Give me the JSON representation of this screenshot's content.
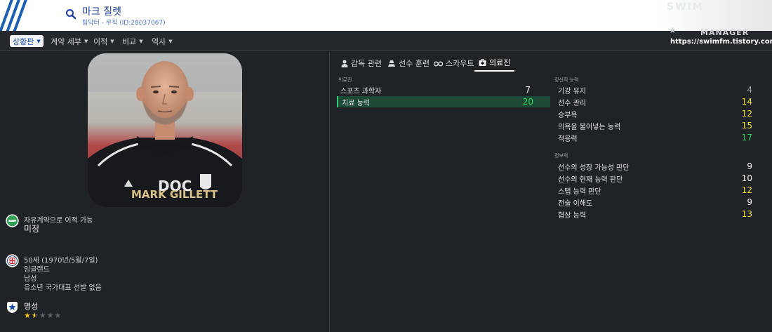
{
  "header": {
    "title": "마크 질렛",
    "subtitle": "팀닥터 - 무직 (ID:28037067)",
    "watermark_logo": "SWIM",
    "watermark_manager": "MANAGER",
    "site_url": "https://swimfm.tistory.com/"
  },
  "nav": {
    "items": [
      {
        "label": "상황판"
      },
      {
        "label": "계약 세부"
      },
      {
        "label": "이적"
      },
      {
        "label": "비교"
      },
      {
        "label": "역사"
      }
    ]
  },
  "profile": {
    "shirt_sponsor": "DOC",
    "shirt_name": "MARK GILLETT",
    "contract_status_label": "자유계약으로 이적 가능",
    "contract_status_value": "미정",
    "age_line": "50세 (1970년/5월/7일)",
    "nationality": "잉글랜드",
    "gender": "남성",
    "youth_caps": "유소년 국가대표 선발 없음",
    "reputation_label": "명성",
    "reputation_stars": 1.5,
    "reputation_max": 5
  },
  "tabs": [
    {
      "label": "감독 관련",
      "icon": "person-icon"
    },
    {
      "label": "선수 훈련",
      "icon": "training-cone-icon"
    },
    {
      "label": "스카우트",
      "icon": "binoculars-icon"
    },
    {
      "label": "의료진",
      "icon": "medical-kit-icon"
    }
  ],
  "medical": {
    "section_label": "의료진",
    "attributes": [
      {
        "name": "스포츠 과학자",
        "value": "7",
        "color": "#ffffff"
      },
      {
        "name": "치료 능력",
        "value": "20",
        "color": "#2ed35c"
      }
    ]
  },
  "mental": {
    "section_label": "정신적 능력",
    "attributes": [
      {
        "name": "기강 유지",
        "value": "4",
        "color": "#9ea3a8"
      },
      {
        "name": "선수 관리",
        "value": "14",
        "color": "#f0e130"
      },
      {
        "name": "승부욕",
        "value": "12",
        "color": "#f0e130"
      },
      {
        "name": "의욕을 불어넣는 능력",
        "value": "15",
        "color": "#f0e130"
      },
      {
        "name": "적응력",
        "value": "17",
        "color": "#2ed35c"
      }
    ]
  },
  "knowledge": {
    "section_label": "정보력",
    "attributes": [
      {
        "name": "선수의 성장 가능성 판단",
        "value": "9",
        "color": "#ffffff"
      },
      {
        "name": "선수의 현재 능력 판단",
        "value": "10",
        "color": "#ffffff"
      },
      {
        "name": "스탭 능력 판단",
        "value": "12",
        "color": "#f0e130"
      },
      {
        "name": "전술 이해도",
        "value": "9",
        "color": "#ffffff"
      },
      {
        "name": "협상 능력",
        "value": "13",
        "color": "#f0e130"
      }
    ]
  },
  "colors": {
    "accent_blue": "#1d4fa8",
    "highlight_row": "#1c4a36",
    "stat_green": "#2ed35c",
    "stat_yellow": "#f0e130"
  }
}
